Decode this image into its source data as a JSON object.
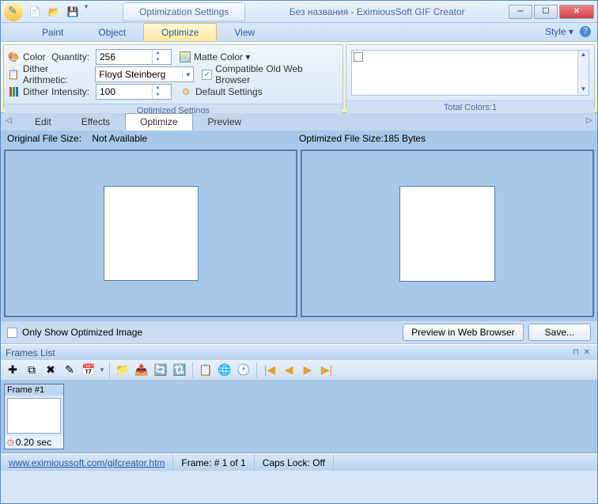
{
  "title": "Без названия - EximiousSoft GIF Creator",
  "title_tab": "Optimization Settings",
  "ribbon_tabs": {
    "paint": "Paint",
    "object": "Object",
    "optimize": "Optimize",
    "view": "View",
    "style": "Style ▾"
  },
  "opt": {
    "color": "Color",
    "quantity": "Quantity:",
    "quantity_val": "256",
    "dither_arith": "Dither Arithmetic:",
    "dither_arith_val": "Floyd Steinberg",
    "dither": "Dither",
    "intensity": "Intensity:",
    "intensity_val": "100",
    "matte": "Matte Color ▾",
    "compat": "Compatible Old Web Browser",
    "defaults": "Default Settings",
    "group_left": "Optimized Settings",
    "group_right": "Total Colors:1"
  },
  "subtabs": {
    "edit": "Edit",
    "effects": "Effects",
    "optimize": "Optimize",
    "preview": "Preview"
  },
  "info": {
    "orig_label": "Original File Size:",
    "orig_val": "Not Available",
    "opt_label": "Optimized File Size:",
    "opt_val": "185 Bytes"
  },
  "only_show": "Only Show Optimized Image",
  "btn_preview": "Preview in Web Browser",
  "btn_save": "Save...",
  "frames_title": "Frames List",
  "frame1": {
    "label": "Frame #1",
    "time": "0.20 sec"
  },
  "status": {
    "url": "www.eximioussoft.com/gifcreator.htm",
    "frame": "Frame: # 1 of 1",
    "caps": "Caps Lock: Off"
  }
}
